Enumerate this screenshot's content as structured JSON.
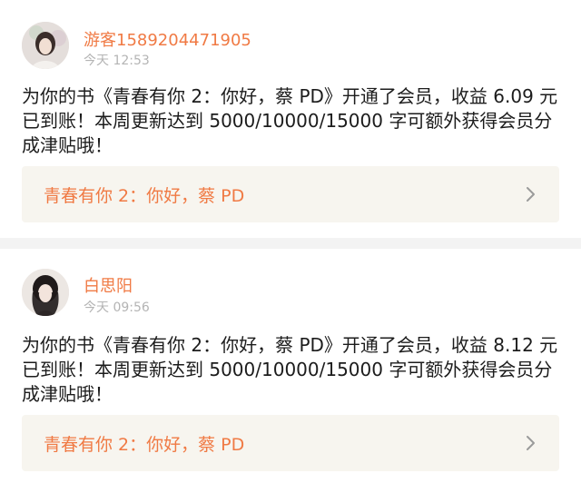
{
  "posts": [
    {
      "user": "游客1589204471905",
      "time": "今天 12:53",
      "message": "为你的书《青春有你 2：你好，蔡 PD》开通了会员，收益 6.09 元已到账！本周更新达到 5000/10000/15000 字可额外获得会员分成津贴哦！",
      "book_title": "青春有你 2：你好，蔡 PD"
    },
    {
      "user": "白思阳",
      "time": "今天 09:56",
      "message": "为你的书《青春有你 2：你好，蔡 PD》开通了会员，收益 8.12 元已到账！本周更新达到 5000/10000/15000 字可额外获得会员分成津贴哦！",
      "book_title": "青春有你 2：你好，蔡 PD"
    }
  ],
  "colors": {
    "accent": "#f07a44",
    "timestamp": "#b4b4b4",
    "book_bg": "#f7f5ef",
    "separator": "#f3f3f3"
  },
  "icons": [
    "avatar",
    "chevron-right-icon"
  ]
}
